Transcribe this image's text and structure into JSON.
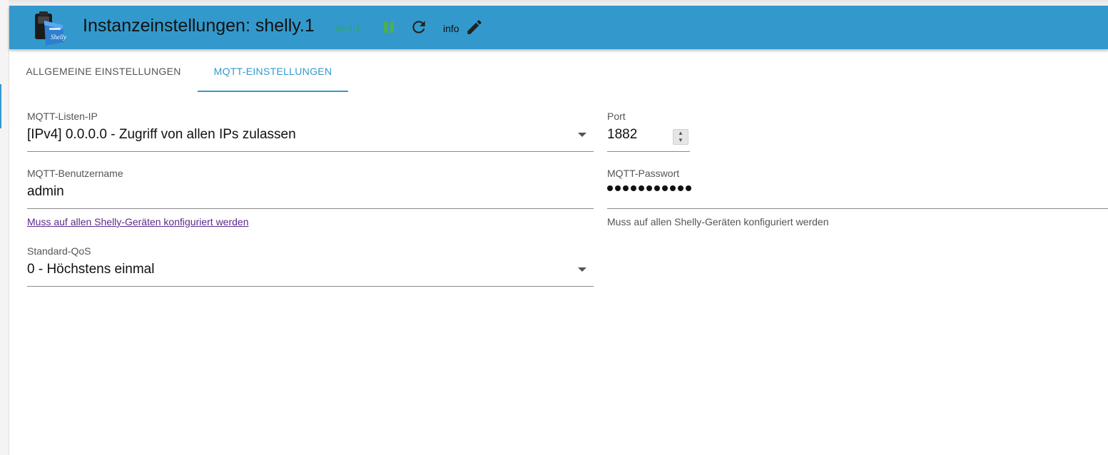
{
  "header": {
    "title": "Instanzeinstellungen: shelly.1",
    "version": "v6.4.1",
    "info_label": "info",
    "colors": {
      "bar": "#3399cc",
      "version": "#2fa84f",
      "running": "#4caf50"
    },
    "icons": [
      "shelly-logo-icon",
      "pause-icon",
      "refresh-icon",
      "pencil-icon"
    ]
  },
  "tabs": [
    {
      "label": "ALLGEMEINE EINSTELLUNGEN",
      "active": false
    },
    {
      "label": "MQTT-EINSTELLUNGEN",
      "active": true
    }
  ],
  "form": {
    "listen_ip": {
      "label": "MQTT-Listen-IP",
      "value": "[IPv4] 0.0.0.0 - Zugriff von allen IPs zulassen"
    },
    "port": {
      "label": "Port",
      "value": "1882"
    },
    "username": {
      "label": "MQTT-Benutzername",
      "value": "admin",
      "helper": "Muss auf allen Shelly-Geräten konfiguriert werden"
    },
    "password": {
      "label": "MQTT-Passwort",
      "masked_length": 11,
      "helper": "Muss auf allen Shelly-Geräten konfiguriert werden"
    },
    "qos": {
      "label": "Standard-QoS",
      "value": "0 - Höchstens einmal"
    }
  }
}
